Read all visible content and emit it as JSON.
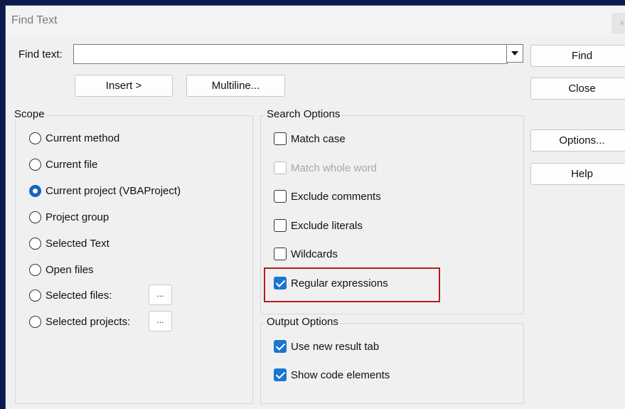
{
  "dialog": {
    "title": "Find Text",
    "close_glyph": "×"
  },
  "find": {
    "label": "Find text:",
    "value": "",
    "placeholder": ""
  },
  "buttons": {
    "insert": "Insert >",
    "multiline": "Multiline...",
    "find": "Find",
    "close": "Close",
    "options": "Options...",
    "help": "Help",
    "browse": "..."
  },
  "scope": {
    "title": "Scope",
    "items": [
      {
        "label": "Current method",
        "selected": false
      },
      {
        "label": "Current file",
        "selected": false
      },
      {
        "label": "Current project (VBAProject)",
        "selected": true
      },
      {
        "label": "Project group",
        "selected": false
      },
      {
        "label": "Selected Text",
        "selected": false
      },
      {
        "label": "Open files",
        "selected": false
      },
      {
        "label": "Selected files:",
        "selected": false
      },
      {
        "label": "Selected projects:",
        "selected": false
      }
    ]
  },
  "search_options": {
    "title": "Search Options",
    "items": [
      {
        "label": "Match case",
        "checked": false,
        "enabled": true
      },
      {
        "label": "Match whole word",
        "checked": false,
        "enabled": false
      },
      {
        "label": "Exclude comments",
        "checked": false,
        "enabled": true
      },
      {
        "label": "Exclude literals",
        "checked": false,
        "enabled": true
      },
      {
        "label": "Wildcards",
        "checked": false,
        "enabled": true
      },
      {
        "label": "Regular expressions",
        "checked": true,
        "enabled": true
      }
    ]
  },
  "output_options": {
    "title": "Output Options",
    "items": [
      {
        "label": "Use new result tab",
        "checked": true
      },
      {
        "label": "Show code elements",
        "checked": true
      }
    ]
  },
  "colors": {
    "accent": "#1976d2",
    "highlight_border": "#b71c1c",
    "background": "#0b1a4a"
  }
}
